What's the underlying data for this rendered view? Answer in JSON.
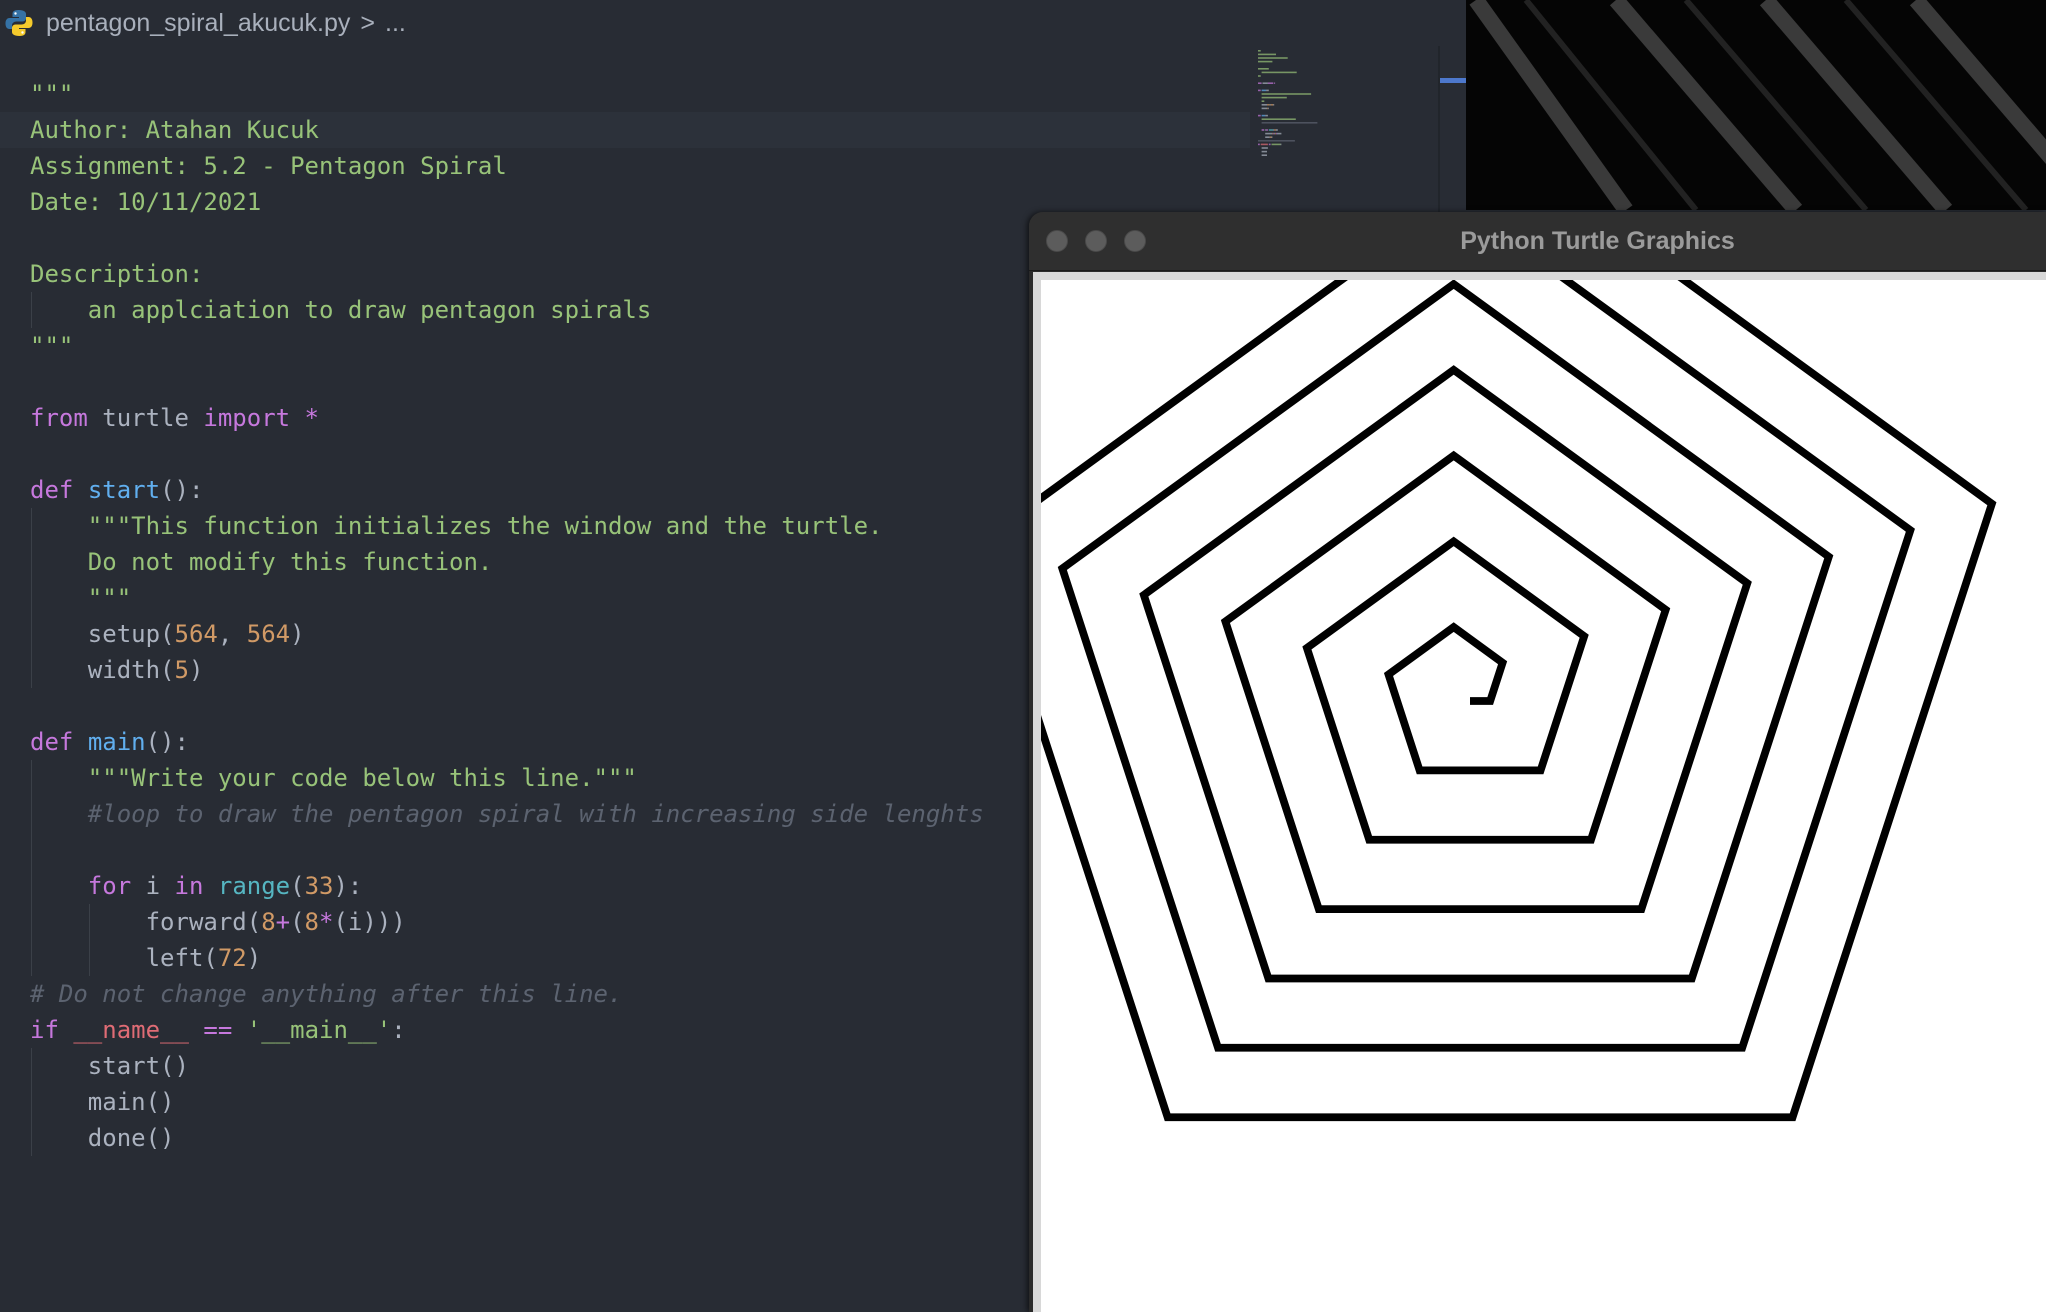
{
  "editor": {
    "breadcrumb": {
      "file": "pentagon_spiral_akucuk.py",
      "separator": ">",
      "more": "..."
    },
    "lines": [
      {
        "indent": 0,
        "tokens": [
          {
            "t": "\"\"\"",
            "c": "str"
          }
        ]
      },
      {
        "indent": 0,
        "highlight": true,
        "tokens": [
          {
            "t": "Author: Atahan Kucuk",
            "c": "str"
          }
        ]
      },
      {
        "indent": 0,
        "tokens": [
          {
            "t": "Assignment: 5.2 - Pentagon Spiral",
            "c": "str"
          }
        ]
      },
      {
        "indent": 0,
        "tokens": [
          {
            "t": "Date: 10/11/2021",
            "c": "str"
          }
        ]
      },
      {
        "indent": 0,
        "tokens": []
      },
      {
        "indent": 0,
        "tokens": [
          {
            "t": "Description:",
            "c": "str"
          }
        ]
      },
      {
        "indent": 1,
        "tokens": [
          {
            "t": "    an applciation to draw pentagon spirals",
            "c": "str"
          }
        ]
      },
      {
        "indent": 0,
        "tokens": [
          {
            "t": "\"\"\"",
            "c": "str"
          }
        ]
      },
      {
        "indent": 0,
        "tokens": []
      },
      {
        "indent": 0,
        "tokens": [
          {
            "t": "from",
            "c": "kw"
          },
          {
            "t": " turtle ",
            "c": "plain"
          },
          {
            "t": "import",
            "c": "kw"
          },
          {
            "t": " *",
            "c": "op"
          }
        ]
      },
      {
        "indent": 0,
        "tokens": []
      },
      {
        "indent": 0,
        "tokens": [
          {
            "t": "def",
            "c": "kw"
          },
          {
            "t": " ",
            "c": "plain"
          },
          {
            "t": "start",
            "c": "fn"
          },
          {
            "t": "():",
            "c": "plain"
          }
        ]
      },
      {
        "indent": 1,
        "tokens": [
          {
            "t": "    \"\"\"This function initializes the window and the turtle.",
            "c": "str"
          }
        ]
      },
      {
        "indent": 1,
        "tokens": [
          {
            "t": "    Do not modify this function.",
            "c": "str"
          }
        ]
      },
      {
        "indent": 1,
        "tokens": [
          {
            "t": "    \"\"\"",
            "c": "str"
          }
        ]
      },
      {
        "indent": 1,
        "tokens": [
          {
            "t": "    setup(",
            "c": "plain"
          },
          {
            "t": "564",
            "c": "num"
          },
          {
            "t": ", ",
            "c": "plain"
          },
          {
            "t": "564",
            "c": "num"
          },
          {
            "t": ")",
            "c": "plain"
          }
        ]
      },
      {
        "indent": 1,
        "tokens": [
          {
            "t": "    width(",
            "c": "plain"
          },
          {
            "t": "5",
            "c": "num"
          },
          {
            "t": ")",
            "c": "plain"
          }
        ]
      },
      {
        "indent": 0,
        "tokens": []
      },
      {
        "indent": 0,
        "tokens": [
          {
            "t": "def",
            "c": "kw"
          },
          {
            "t": " ",
            "c": "plain"
          },
          {
            "t": "main",
            "c": "fn"
          },
          {
            "t": "():",
            "c": "plain"
          }
        ]
      },
      {
        "indent": 1,
        "tokens": [
          {
            "t": "    \"\"\"Write your code below this line.\"\"\"",
            "c": "str"
          }
        ]
      },
      {
        "indent": 1,
        "tokens": [
          {
            "t": "    #loop to draw the pentagon spiral with increasing side lenghts",
            "c": "cmt"
          }
        ]
      },
      {
        "indent": 1,
        "tokens": []
      },
      {
        "indent": 1,
        "tokens": [
          {
            "t": "    ",
            "c": "plain"
          },
          {
            "t": "for",
            "c": "kw"
          },
          {
            "t": " i ",
            "c": "plain"
          },
          {
            "t": "in",
            "c": "kw"
          },
          {
            "t": " ",
            "c": "plain"
          },
          {
            "t": "range",
            "c": "builtin"
          },
          {
            "t": "(",
            "c": "plain"
          },
          {
            "t": "33",
            "c": "num"
          },
          {
            "t": "):",
            "c": "plain"
          }
        ]
      },
      {
        "indent": 2,
        "tokens": [
          {
            "t": "        forward(",
            "c": "plain"
          },
          {
            "t": "8",
            "c": "num"
          },
          {
            "t": "+",
            "c": "op"
          },
          {
            "t": "(",
            "c": "plain"
          },
          {
            "t": "8",
            "c": "num"
          },
          {
            "t": "*",
            "c": "op"
          },
          {
            "t": "(i)))",
            "c": "plain"
          }
        ]
      },
      {
        "indent": 2,
        "tokens": [
          {
            "t": "        left(",
            "c": "plain"
          },
          {
            "t": "72",
            "c": "num"
          },
          {
            "t": ")",
            "c": "plain"
          }
        ]
      },
      {
        "indent": 0,
        "tokens": [
          {
            "t": "# Do not change anything after this line.",
            "c": "cmt"
          }
        ]
      },
      {
        "indent": 0,
        "tokens": [
          {
            "t": "if",
            "c": "kw"
          },
          {
            "t": " ",
            "c": "plain"
          },
          {
            "t": "__name__",
            "c": "var"
          },
          {
            "t": " ",
            "c": "plain"
          },
          {
            "t": "==",
            "c": "op"
          },
          {
            "t": " ",
            "c": "plain"
          },
          {
            "t": "'__main__'",
            "c": "str"
          },
          {
            "t": ":",
            "c": "plain"
          }
        ]
      },
      {
        "indent": 1,
        "tokens": [
          {
            "t": "    start()",
            "c": "plain"
          }
        ]
      },
      {
        "indent": 1,
        "tokens": [
          {
            "t": "    main()",
            "c": "plain"
          }
        ]
      },
      {
        "indent": 1,
        "tokens": [
          {
            "t": "    done()",
            "c": "plain"
          }
        ]
      }
    ]
  },
  "turtle_window": {
    "title": "Python Turtle Graphics",
    "spiral": {
      "iterations": 33,
      "base_step": 8,
      "step_increment": 8,
      "turn_degrees": 72,
      "pen_width": 5,
      "pen_color": "#000000"
    }
  },
  "colors": {
    "editor_bg": "#282c34",
    "string": "#98c379",
    "keyword": "#c678dd",
    "function": "#61afef",
    "number": "#d19a66",
    "builtin": "#56b6c2",
    "comment": "#5c6370",
    "variable": "#e06c75"
  }
}
